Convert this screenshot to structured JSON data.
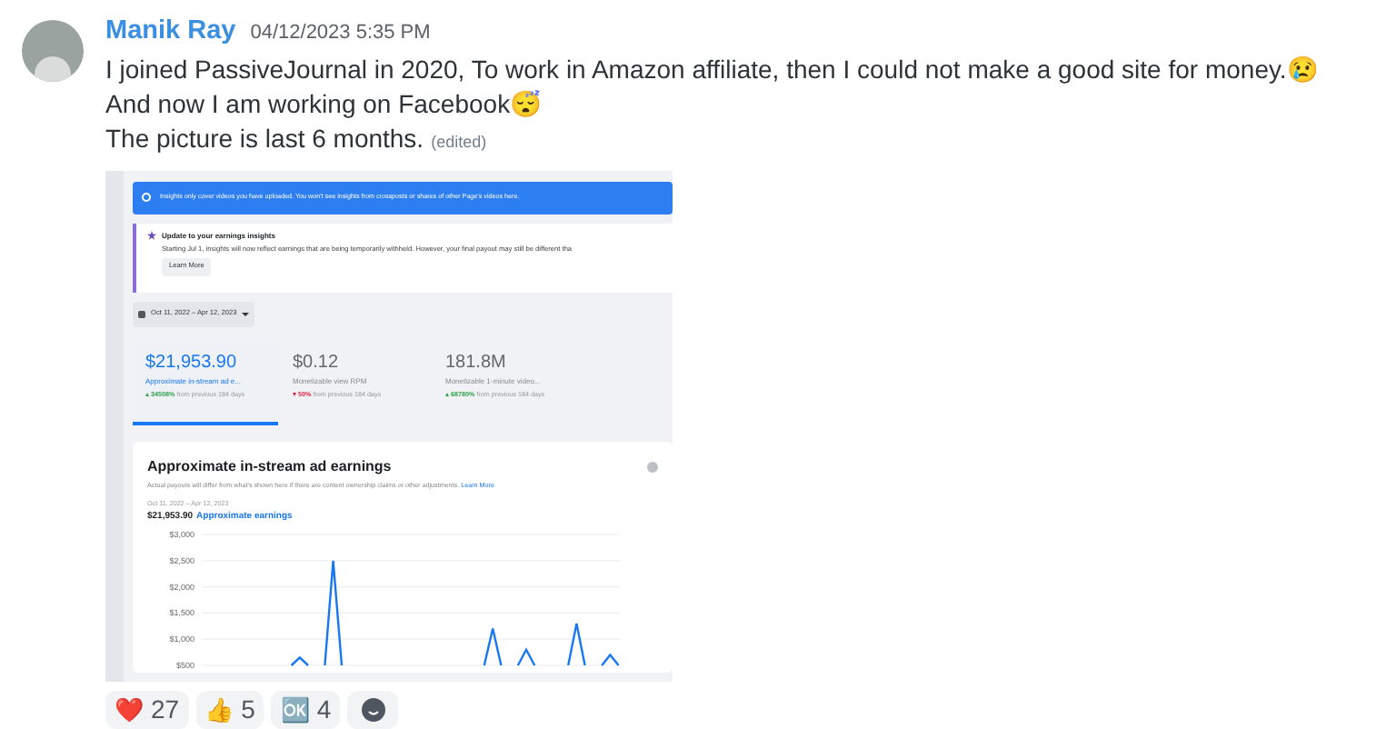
{
  "message": {
    "author": "Manik Ray",
    "timestamp": "04/12/2023 5:35 PM",
    "lines": [
      "I joined PassiveJournal in 2020, To work in Amazon affiliate, then I could not make a good site for money.😢",
      "And now I am working on Facebook😴",
      "The picture is last 6 months."
    ],
    "edited": "(edited)"
  },
  "attachment": {
    "banner": "Insights only cover videos you have uploaded. You won't see insights from crossposts or shares of other Page's videos here.",
    "notice": {
      "title": "Update to your earnings insights",
      "body": "Starting Jul 1, insights will now reflect earnings that are being temporarily withheld. However, your final payout may still be different tha",
      "button": "Learn More"
    },
    "date_range": "Oct 11, 2022 – Apr 12, 2023",
    "metrics": [
      {
        "value": "$21,953.90",
        "label": "Approximate in-stream ad e...",
        "change": "34508%",
        "note": "from previous 184 days",
        "increase": true,
        "selected": true
      },
      {
        "value": "$0.12",
        "label": "Monetizable view RPM",
        "change": "50%",
        "note": "from previous 184 days",
        "increase": false,
        "selected": false
      },
      {
        "value": "181.8M",
        "label": "Monetizable 1-minute video...",
        "change": "68780%",
        "note": "from previous 184 days",
        "increase": true,
        "selected": false
      }
    ],
    "chart_card": {
      "title": "Approximate in-stream ad earnings",
      "subtitle": "Actual payouts will differ from what's shown here if there are content ownership claims or other adjustments.",
      "link": "Learn More",
      "date_range": "Oct 11, 2022 – Apr 12, 2023",
      "total": "$21,953.90",
      "chart_data": {
        "type": "line",
        "grid": true,
        "ylim": [
          500,
          3000
        ],
        "yticks": [
          {
            "value": 3000,
            "label": "$3,000"
          },
          {
            "value": 2500,
            "label": "$2,500"
          },
          {
            "value": 2000,
            "label": "$2,000"
          },
          {
            "value": 1500,
            "label": "$1,500"
          },
          {
            "value": 1000,
            "label": "$1,000"
          },
          {
            "value": 500,
            "label": "$500"
          }
        ],
        "series": [
          {
            "name": "Approximate earnings",
            "color": "#1877f2",
            "values": [
              null,
              null,
              null,
              null,
              null,
              null,
              null,
              null,
              null,
              null,
              500,
              650,
              500,
              null,
              500,
              2500,
              500,
              null,
              null,
              null,
              null,
              null,
              null,
              null,
              null,
              null,
              null,
              null,
              null,
              null,
              null,
              null,
              null,
              500,
              1200,
              500,
              null,
              500,
              800,
              500,
              null,
              null,
              null,
              500,
              1300,
              500,
              null,
              500,
              700,
              500
            ]
          }
        ]
      }
    }
  },
  "reactions": [
    {
      "emoji": "❤️",
      "count": "27"
    },
    {
      "emoji": "👍",
      "count": "5"
    },
    {
      "emoji": "🆗",
      "count": "4"
    }
  ]
}
